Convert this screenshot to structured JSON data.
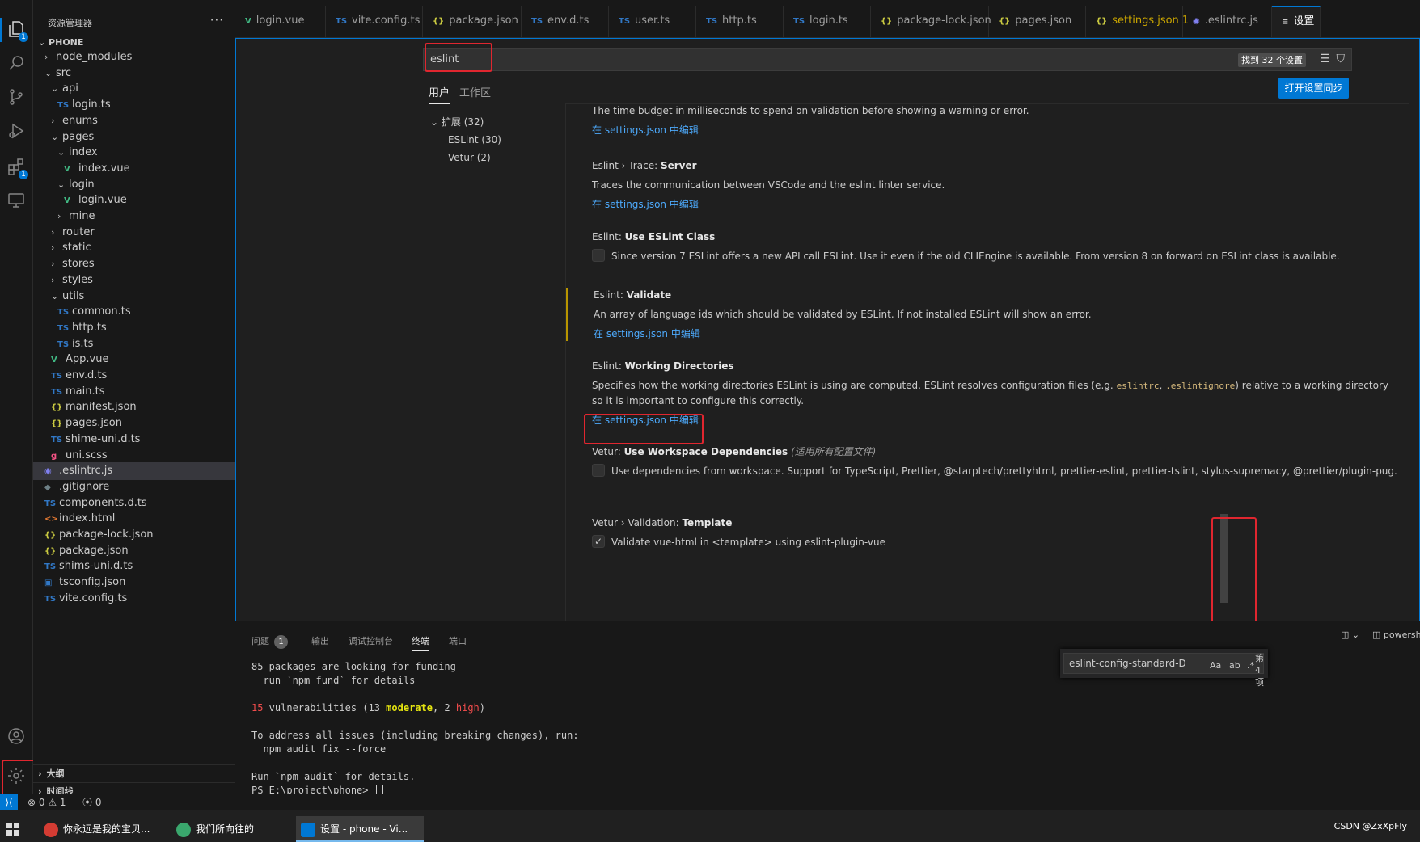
{
  "colors": {
    "accent": "#0078d4",
    "highlight_box": "#e0262f",
    "link": "#4daafc",
    "modified": "#b89500"
  },
  "activity_bar": {
    "badges": {
      "explorer": "1",
      "extensions": "1"
    },
    "icons": [
      "files-icon",
      "search-icon",
      "source-control-icon",
      "run-debug-icon",
      "extensions-icon",
      "remote-explorer-icon",
      "account-icon",
      "gear-icon"
    ]
  },
  "sidebar": {
    "title": "资源管理器",
    "more": "···",
    "root": "PHONE",
    "items": [
      {
        "label": "node_modules",
        "chev": "›",
        "icon": ""
      },
      {
        "label": "src",
        "chev": "⌄",
        "icon": ""
      },
      {
        "label": "api",
        "chev": "⌄",
        "icon": ""
      },
      {
        "label": "login.ts",
        "chev": "",
        "icon": "TS"
      },
      {
        "label": "enums",
        "chev": "›",
        "icon": ""
      },
      {
        "label": "pages",
        "chev": "⌄",
        "icon": ""
      },
      {
        "label": "index",
        "chev": "⌄",
        "icon": ""
      },
      {
        "label": "index.vue",
        "chev": "",
        "icon": "V"
      },
      {
        "label": "login",
        "chev": "⌄",
        "icon": ""
      },
      {
        "label": "login.vue",
        "chev": "",
        "icon": "V"
      },
      {
        "label": "mine",
        "chev": "›",
        "icon": ""
      },
      {
        "label": "router",
        "chev": "›",
        "icon": ""
      },
      {
        "label": "static",
        "chev": "›",
        "icon": ""
      },
      {
        "label": "stores",
        "chev": "›",
        "icon": ""
      },
      {
        "label": "styles",
        "chev": "›",
        "icon": ""
      },
      {
        "label": "utils",
        "chev": "⌄",
        "icon": ""
      },
      {
        "label": "common.ts",
        "chev": "",
        "icon": "TS"
      },
      {
        "label": "http.ts",
        "chev": "",
        "icon": "TS"
      },
      {
        "label": "is.ts",
        "chev": "",
        "icon": "TS"
      },
      {
        "label": "App.vue",
        "chev": "",
        "icon": "V"
      },
      {
        "label": "env.d.ts",
        "chev": "",
        "icon": "TS"
      },
      {
        "label": "main.ts",
        "chev": "",
        "icon": "TS"
      },
      {
        "label": "manifest.json",
        "chev": "",
        "icon": "{}"
      },
      {
        "label": "pages.json",
        "chev": "",
        "icon": "{}"
      },
      {
        "label": "shime-uni.d.ts",
        "chev": "",
        "icon": "TS"
      },
      {
        "label": "uni.scss",
        "chev": "",
        "icon": "ǥ"
      },
      {
        "label": ".eslintrc.js",
        "chev": "",
        "icon": "◉"
      },
      {
        "label": ".gitignore",
        "chev": "",
        "icon": "◆"
      },
      {
        "label": "components.d.ts",
        "chev": "",
        "icon": "TS"
      },
      {
        "label": "index.html",
        "chev": "",
        "icon": "<>"
      },
      {
        "label": "package-lock.json",
        "chev": "",
        "icon": "{}"
      },
      {
        "label": "package.json",
        "chev": "",
        "icon": "{}"
      },
      {
        "label": "shims-uni.d.ts",
        "chev": "",
        "icon": "TS"
      },
      {
        "label": "tsconfig.json",
        "chev": "",
        "icon": "▣"
      },
      {
        "label": "vite.config.ts",
        "chev": "",
        "icon": "TS"
      }
    ],
    "outline": "大纲",
    "timeline": "时间线"
  },
  "tabs": [
    {
      "label": "login.vue",
      "icon": "V"
    },
    {
      "label": "vite.config.ts",
      "icon": "TS"
    },
    {
      "label": "package.json",
      "icon": "{}"
    },
    {
      "label": "env.d.ts",
      "icon": "TS"
    },
    {
      "label": "user.ts",
      "icon": "TS"
    },
    {
      "label": "http.ts",
      "icon": "TS"
    },
    {
      "label": "login.ts",
      "icon": "TS"
    },
    {
      "label": "package-lock.json",
      "icon": "{}"
    },
    {
      "label": "pages.json",
      "icon": "{}"
    },
    {
      "label": "settings.json 1",
      "icon": "{}"
    },
    {
      "label": ".eslintrc.js",
      "icon": "◉"
    },
    {
      "label": "设置",
      "icon": "≡"
    }
  ],
  "settings": {
    "search_value": "eslint",
    "found": "找到 32 个设置",
    "scope_user": "用户",
    "scope_workspace": "工作区",
    "sync_button": "打开设置同步",
    "toc": {
      "group": "扩展 (32)",
      "items": [
        "ESLint (30)",
        "Vetur (2)"
      ]
    },
    "partial_desc": "The time budget in milliseconds to spend on validation before showing a warning or error.",
    "edit_link": "在 settings.json 中编辑",
    "items": [
      {
        "prefix": "Eslint › Trace: ",
        "name": "Server",
        "desc": "Traces the communication between VSCode and the eslint linter service."
      },
      {
        "prefix": "Eslint: ",
        "name": "Use ESLint Class",
        "desc": "Since version 7 ESLint offers a new API call ESLint. Use it even if the old CLIEngine is available. From version 8 on forward on ESLint class is available."
      },
      {
        "prefix": "Eslint: ",
        "name": "Validate",
        "desc": "An array of language ids which should be validated by ESLint. If not installed ESLint will show an error."
      },
      {
        "prefix": "Eslint: ",
        "name": "Working Directories",
        "desc_a": "Specifies how the working directories ESLint is using are computed. ESLint resolves configuration files (e.g. ",
        "code_1": "eslintrc",
        "sep": ", ",
        "code_2": ".eslintignore",
        "desc_b": ") relative to a working directory so it is important to configure this correctly."
      },
      {
        "prefix": "Vetur: ",
        "name": "Use Workspace Dependencies",
        "scope_note": "(适用所有配置文件)",
        "desc": "Use dependencies from workspace. Support for TypeScript, Prettier, @starptech/prettyhtml, prettier-eslint, prettier-tslint, stylus-supremacy, @prettier/plugin-pug."
      },
      {
        "prefix": "Vetur › Validation: ",
        "name": "Template",
        "desc": "Validate vue-html in <template> using eslint-plugin-vue"
      }
    ]
  },
  "panel": {
    "tabs": [
      "问题",
      "输出",
      "调试控制台",
      "终端",
      "端口"
    ],
    "problems_count": "1",
    "shell": "powersh",
    "terminal": {
      "l1": "85 packages are looking for funding",
      "l2": "  run `npm fund` for details",
      "l3_count": "15",
      "l3_a": " vulnerabilities (13 ",
      "l3_mod": "moderate",
      "l3_b": ", 2 ",
      "l3_high": "high",
      "l3_c": ")",
      "l4": "To address all issues (including breaking changes), run:",
      "l5": "  npm audit fix --force",
      "l6": "Run `npm audit` for details.",
      "l7": "PS E:\\project\\phone> "
    },
    "find_value": "eslint-config-standard-D",
    "find_opts": [
      "Aa",
      "ab",
      ".*"
    ],
    "find_count": "第 4 项"
  },
  "statusbar": {
    "errors": "0",
    "warnings": "1",
    "ports": "0"
  },
  "taskbar": {
    "apps": [
      "你永远是我的宝贝...",
      "我们所向往的",
      "设置 - phone - Vi..."
    ],
    "watermark": "CSDN @ZxXpFly"
  }
}
